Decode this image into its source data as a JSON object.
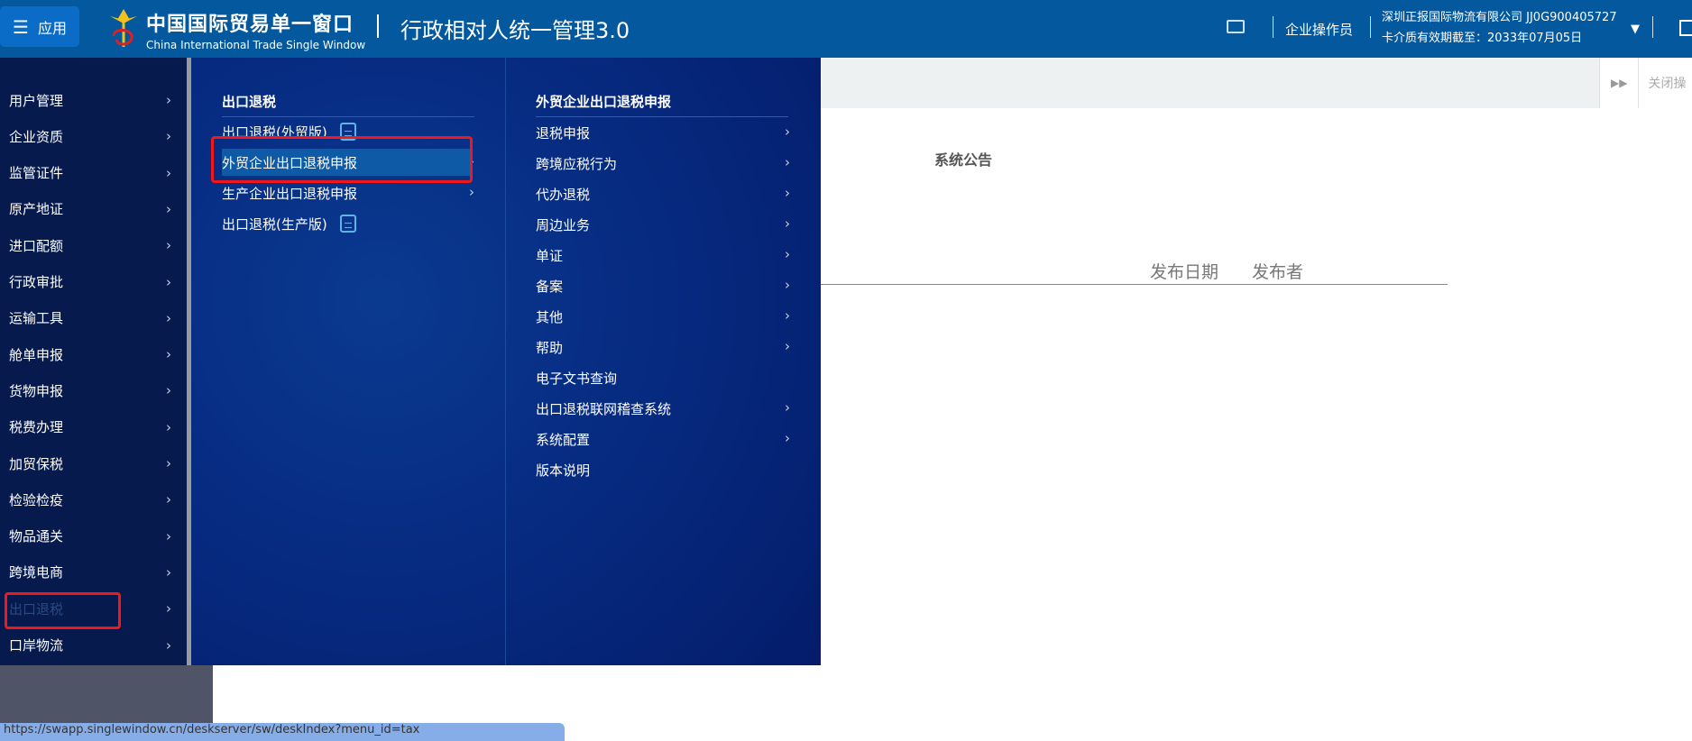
{
  "header": {
    "app_label": "应用",
    "brand_cn": "中国国际贸易单一窗口",
    "brand_en": "China International Trade Single Window",
    "system_title": "行政相对人统一管理3.0",
    "role": "企业操作员",
    "company": "深圳正报国际物流有限公司 JJ0G900405727",
    "card_expiry": "卡介质有效期截至：2033年07月05日",
    "dropdown": "▼"
  },
  "left_menu": [
    {
      "label": "用户管理"
    },
    {
      "label": "企业资质"
    },
    {
      "label": "监管证件"
    },
    {
      "label": "原产地证"
    },
    {
      "label": "进口配额"
    },
    {
      "label": "行政审批"
    },
    {
      "label": "运输工具"
    },
    {
      "label": "舱单申报"
    },
    {
      "label": "货物申报"
    },
    {
      "label": "税费办理"
    },
    {
      "label": "加贸保税"
    },
    {
      "label": "检验检疫"
    },
    {
      "label": "物品通关"
    },
    {
      "label": "跨境电商"
    },
    {
      "label": "出口退税",
      "active": true
    },
    {
      "label": "口岸物流"
    }
  ],
  "panel": {
    "col1": {
      "title": "出口退税",
      "items": [
        {
          "label": "出口退税(外贸版)",
          "icon": "book-icon"
        },
        {
          "label": "外贸企业出口退税申报",
          "selected": true,
          "chevron": true
        },
        {
          "label": "生产企业出口退税申报",
          "chevron": true
        },
        {
          "label": "出口退税(生产版)",
          "icon": "book-icon"
        }
      ]
    },
    "col2": {
      "title": "外贸企业出口退税申报",
      "items": [
        {
          "label": "退税申报",
          "chevron": true
        },
        {
          "label": "跨境应税行为",
          "chevron": true
        },
        {
          "label": "代办退税",
          "chevron": true
        },
        {
          "label": "周边业务",
          "chevron": true
        },
        {
          "label": "单证",
          "chevron": true
        },
        {
          "label": "备案",
          "chevron": true
        },
        {
          "label": "其他",
          "chevron": true
        },
        {
          "label": "帮助",
          "chevron": true
        },
        {
          "label": "电子文书查询"
        },
        {
          "label": "出口退税联网稽查系统",
          "chevron": true
        },
        {
          "label": "系统配置",
          "chevron": true
        },
        {
          "label": "版本说明"
        }
      ]
    }
  },
  "tabs": {
    "close_label": "关闭操"
  },
  "content": {
    "title": "系统公告",
    "col_date": "发布日期",
    "col_publisher": "发布者"
  },
  "status_url": "https://swapp.singlewindow.cn/deskserver/sw/deskIndex?menu_id=tax"
}
